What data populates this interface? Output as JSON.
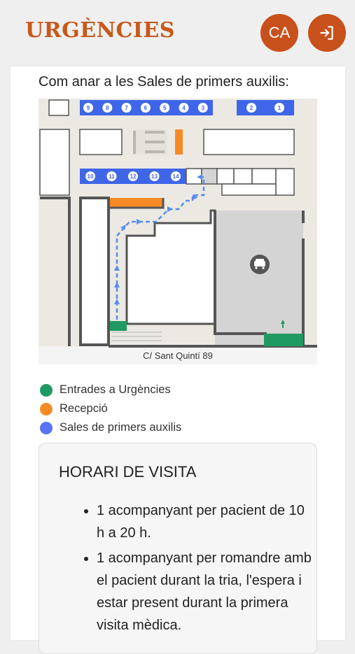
{
  "header": {
    "title": "URGÈNCIES",
    "language_label": "CA",
    "login_icon": "login-icon"
  },
  "directions": {
    "heading": "Com anar a les Sales de primers auxilis:",
    "map": {
      "street_label": "C/ Sant Quintí 89",
      "top_rooms": [
        "9",
        "8",
        "7",
        "6",
        "5",
        "4",
        "3"
      ],
      "top_right_rooms": [
        "2",
        "1"
      ],
      "middle_rooms": [
        "10",
        "11",
        "12",
        "13",
        "14"
      ],
      "parking_icon": "car-icon",
      "colors": {
        "entrance": "#1f9a62",
        "reception": "#f58a25",
        "rooms": "#3f66e8",
        "path": "#5b8cf0",
        "walls": "#555555",
        "grey_area": "#d4d4d4"
      }
    }
  },
  "legend": [
    {
      "label": "Entrades a Urgències",
      "color": "#1f9a62"
    },
    {
      "label": "Recepció",
      "color": "#f58a25"
    },
    {
      "label": "Sales de primers auxilis",
      "color": "#5a73f0"
    }
  ],
  "visiting_hours": {
    "title": "HORARI DE VISITA",
    "items": [
      "1 acompanyant per pacient de 10 h a 20 h.",
      "1 acompanyant per romandre amb el pacient durant la tria, l'espera i estar present durant la primera visita mèdica."
    ]
  }
}
